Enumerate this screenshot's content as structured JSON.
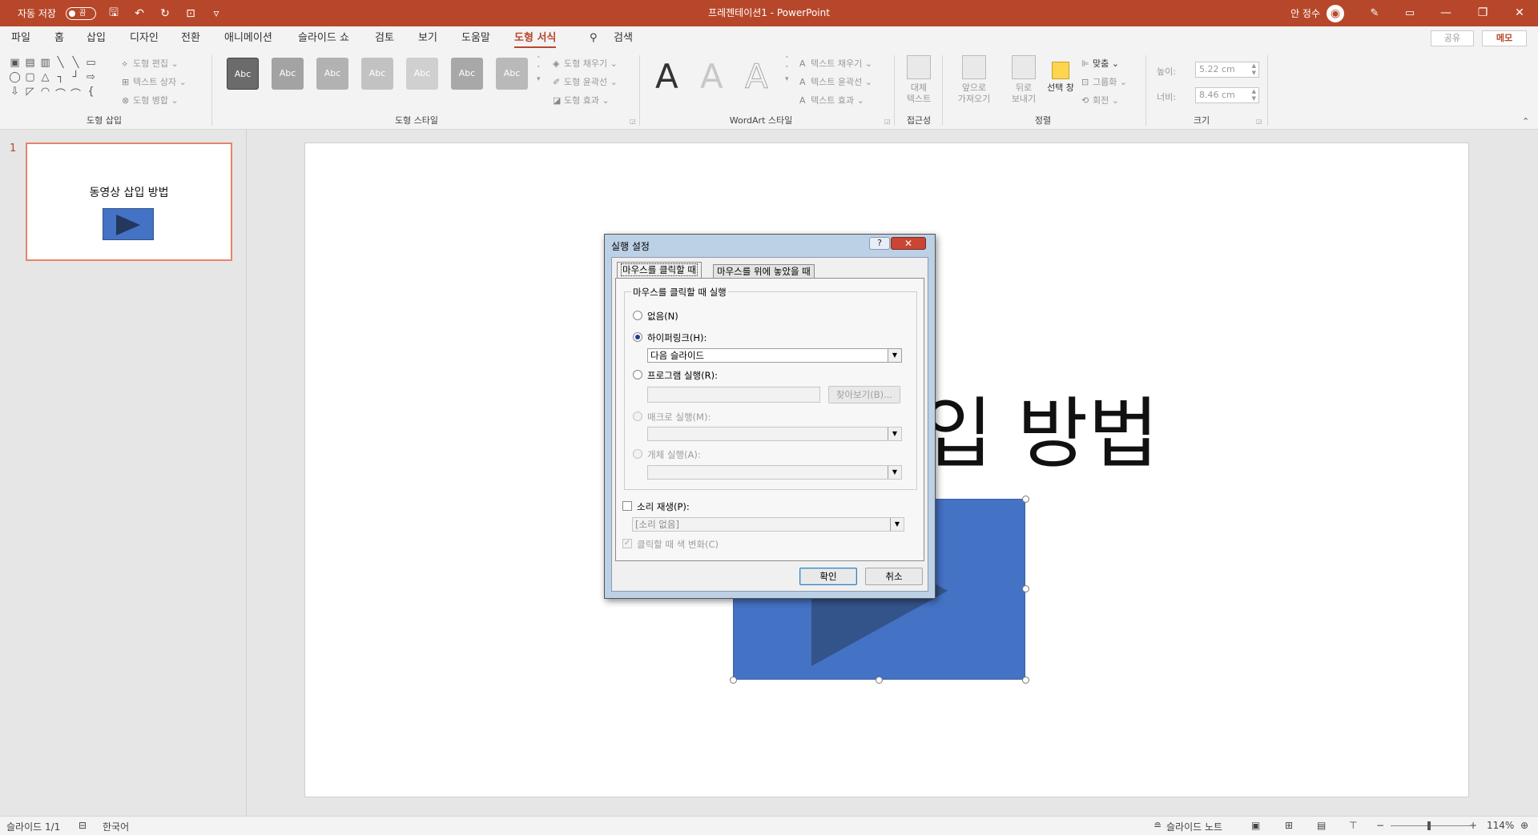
{
  "titlebar": {
    "autosave_label": "자동 저장",
    "autosave_state": "끔",
    "doc_title": "프레젠테이션1 - PowerPoint",
    "user_name": "안 정수"
  },
  "tabs": [
    {
      "label": "파일"
    },
    {
      "label": "홈"
    },
    {
      "label": "삽입"
    },
    {
      "label": "디자인"
    },
    {
      "label": "전환"
    },
    {
      "label": "애니메이션"
    },
    {
      "label": "슬라이드 쇼"
    },
    {
      "label": "검토"
    },
    {
      "label": "보기"
    },
    {
      "label": "도움말"
    },
    {
      "label": "도형 서식",
      "active": true
    },
    {
      "label": "검색"
    }
  ],
  "ribbon_right": {
    "share": "공유",
    "memo": "메모"
  },
  "ribbon": {
    "shape_insert": {
      "edit_shape": "도형 편집",
      "text_box": "텍스트 상자",
      "merge_shapes": "도형 병합",
      "label": "도형 삽입"
    },
    "shape_styles": {
      "style_text": "Abc",
      "fill": "도형 채우기",
      "outline": "도형 윤곽선",
      "effects": "도형 효과",
      "label": "도형 스타일"
    },
    "wordart": {
      "letter": "A",
      "text_fill": "텍스트 채우기",
      "text_outline": "텍스트 윤곽선",
      "text_effects": "텍스트 효과",
      "label": "WordArt 스타일"
    },
    "accessibility": {
      "alt_text_1": "대체",
      "alt_text_2": "텍스트",
      "label": "접근성"
    },
    "arrange": {
      "bring_forward_1": "앞으로",
      "bring_forward_2": "가져오기",
      "send_backward_1": "뒤로",
      "send_backward_2": "보내기",
      "selection_pane": "선택 창",
      "align": "맞춤",
      "group": "그룹화",
      "rotate": "회전",
      "label": "정렬"
    },
    "size": {
      "height_label": "높이:",
      "height_value": "5.22 cm",
      "width_label": "너비:",
      "width_value": "8.46 cm",
      "label": "크기"
    }
  },
  "slides_pane": {
    "number": "1",
    "thumb_title": "동영상 삽입 방법"
  },
  "slide": {
    "title": "동영상 삽입 방법",
    "colors": {
      "shape_fill": "#4472c4",
      "triangle": "#2c4773"
    }
  },
  "dialog": {
    "title": "실행 설정",
    "help": "?",
    "close": "✕",
    "tab_click": "마우스를 클릭할 때",
    "tab_hover": "마우스를 위에 놓았을 때",
    "group_legend": "마우스를 클릭할 때 실행",
    "opt_none": "없음(N)",
    "opt_hyperlink": "하이퍼링크(H):",
    "hyperlink_value": "다음 슬라이드",
    "opt_program": "프로그램 실행(R):",
    "program_value": "",
    "browse": "찾아보기(B)...",
    "opt_macro": "매크로 실행(M):",
    "macro_value": "",
    "opt_object": "개체 실행(A):",
    "object_value": "",
    "play_sound": "소리 재생(P):",
    "sound_value": "[소리 없음]",
    "highlight_click": "클릭할 때 색 변화(C)",
    "ok": "확인",
    "cancel": "취소",
    "selected_option": "hyperlink"
  },
  "statusbar": {
    "slide_counter": "슬라이드 1/1",
    "language": "한국어",
    "notes": "슬라이드 노트",
    "zoom": "114%"
  },
  "colors": {
    "accent": "#b7472a",
    "dialog_frame": "#bcd0e6"
  }
}
